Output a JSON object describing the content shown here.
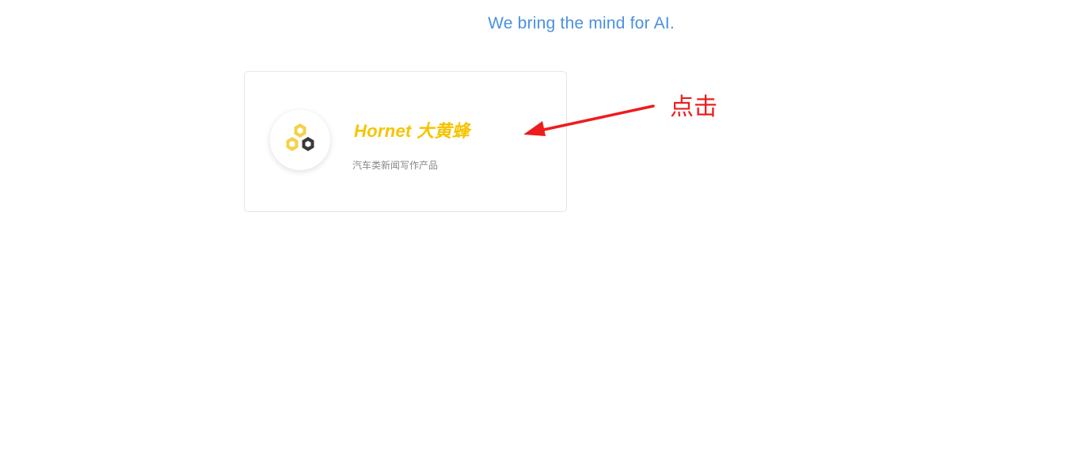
{
  "header": {
    "tagline": "We bring the mind for AI."
  },
  "product_card": {
    "name": "Hornet 大黄蜂",
    "description": "汽车类新闻写作产品",
    "logo_icon": "hexagon-cluster-icon",
    "name_color": "#f5c400"
  },
  "annotation": {
    "label": "点击",
    "color": "#ee1c1c",
    "icon": "red-arrow-icon"
  },
  "colors": {
    "tagline": "#4a90e2",
    "hex_yellow": "#f5d04a",
    "hex_dark": "#3a3a3a"
  }
}
